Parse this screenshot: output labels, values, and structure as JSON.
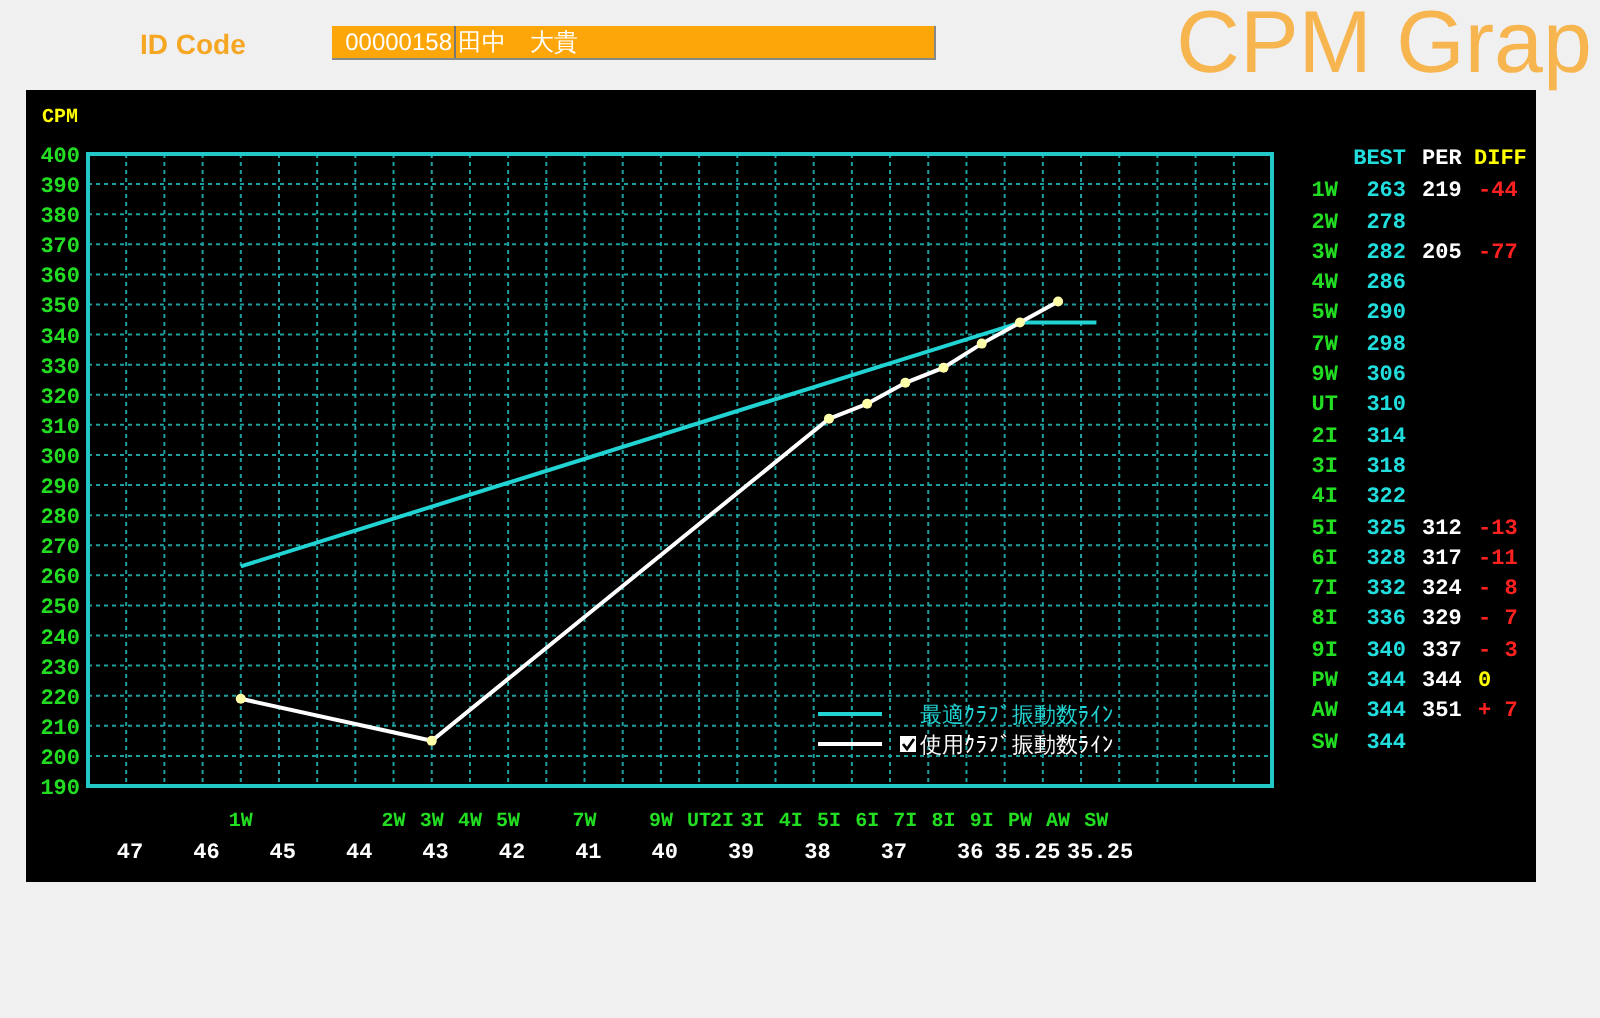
{
  "header": {
    "id_label": "ID Code",
    "id_value": "00000158",
    "name_value": "田中　大貴",
    "title": "CPM Grap"
  },
  "chart": {
    "axis_title": "CPM",
    "length_labels": [
      "47",
      "46",
      "45",
      "44",
      "43",
      "42",
      "41",
      "40",
      "39",
      "38",
      "37",
      "36",
      "35.25",
      "35.25"
    ],
    "chart_data": {
      "type": "line",
      "grid": true,
      "legend": true,
      "ylim": [
        190,
        400
      ],
      "yticks": [
        190,
        200,
        210,
        220,
        230,
        240,
        250,
        260,
        270,
        280,
        290,
        300,
        310,
        320,
        330,
        340,
        350,
        360,
        370,
        380,
        390,
        400
      ],
      "categories": [
        "1W",
        "2W",
        "3W",
        "4W",
        "5W",
        "7W",
        "9W",
        "UT",
        "2I",
        "3I",
        "4I",
        "5I",
        "6I",
        "7I",
        "8I",
        "9I",
        "PW",
        "AW",
        "SW"
      ],
      "series": [
        {
          "name": "最適ｸﾗﾌﾞ振動数ﾗｲﾝ",
          "color": "#22d3d3",
          "values": [
            263,
            null,
            null,
            null,
            null,
            null,
            null,
            null,
            null,
            null,
            null,
            null,
            null,
            null,
            null,
            null,
            344,
            null,
            344
          ]
        },
        {
          "name": "使用ｸﾗﾌﾞ振動数ﾗｲﾝ",
          "color": "#ffffff",
          "marker": "circle",
          "values": [
            219,
            null,
            205,
            null,
            null,
            null,
            null,
            null,
            null,
            null,
            null,
            312,
            317,
            324,
            329,
            337,
            344,
            351,
            null
          ]
        }
      ]
    },
    "legend": [
      {
        "checked": false
      },
      {
        "checked": true
      }
    ]
  },
  "table": {
    "columns": [
      "BEST",
      "PER",
      "DIFF"
    ],
    "rows": [
      {
        "club": "1W",
        "best": "263",
        "per": "219",
        "diff": "-44",
        "color": "#ff2020"
      },
      {
        "club": "2W",
        "best": "278"
      },
      {
        "club": "3W",
        "best": "282",
        "per": "205",
        "diff": "-77",
        "color": "#ff2020"
      },
      {
        "club": "4W",
        "best": "286"
      },
      {
        "club": "5W",
        "best": "290"
      },
      {
        "club": "7W",
        "best": "298"
      },
      {
        "club": "9W",
        "best": "306"
      },
      {
        "club": "UT",
        "best": "310"
      },
      {
        "club": "2I",
        "best": "314"
      },
      {
        "club": "3I",
        "best": "318"
      },
      {
        "club": "4I",
        "best": "322"
      },
      {
        "club": "5I",
        "best": "325",
        "per": "312",
        "diff": "-13",
        "color": "#ff2020"
      },
      {
        "club": "6I",
        "best": "328",
        "per": "317",
        "diff": "-11",
        "color": "#ff2020"
      },
      {
        "club": "7I",
        "best": "332",
        "per": "324",
        "diff": "- 8",
        "color": "#ff2020"
      },
      {
        "club": "8I",
        "best": "336",
        "per": "329",
        "diff": "- 7",
        "color": "#ff2020"
      },
      {
        "club": "9I",
        "best": "340",
        "per": "337",
        "diff": "- 3",
        "color": "#ff2020"
      },
      {
        "club": "PW",
        "best": "344",
        "per": "344",
        "diff": "0",
        "color": "#ffff00"
      },
      {
        "club": "AW",
        "best": "344",
        "per": "351",
        "diff": "+ 7",
        "color": "#ff2020"
      },
      {
        "club": "SW",
        "best": "344"
      }
    ]
  }
}
